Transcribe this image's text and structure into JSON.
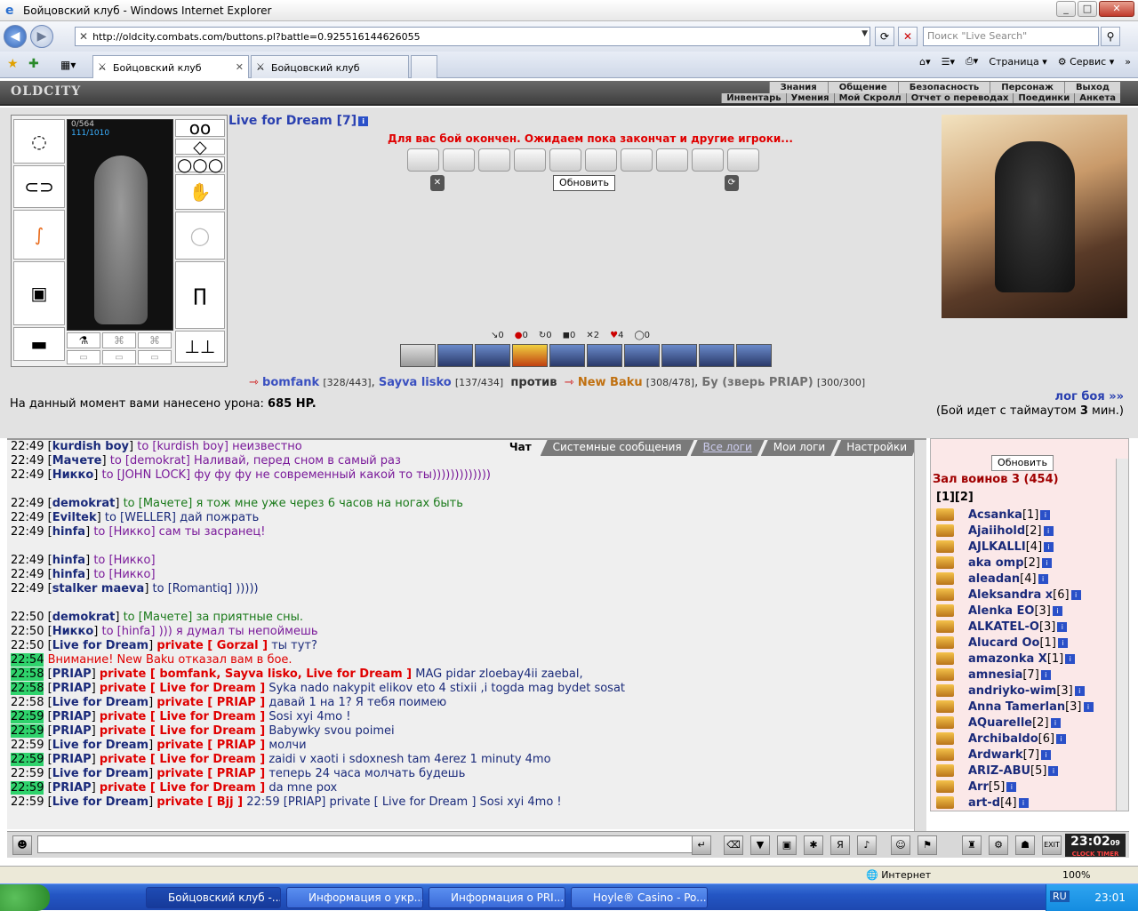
{
  "window": {
    "title": "Бойцовский клуб - Windows Internet Explorer"
  },
  "nav": {
    "url": "http://oldcity.combats.com/buttons.pl?battle=0.925516144626055",
    "search_placeholder": "Поиск \"Live Search\""
  },
  "tabs": [
    {
      "label": "Бойцовский клуб"
    },
    {
      "label": "Бойцовский клуб"
    }
  ],
  "commands": {
    "page": "Страница",
    "service": "Сервис"
  },
  "game": {
    "logo": "OLDCITY",
    "menu": [
      "Знания",
      "Общение",
      "Безопасность",
      "Персонаж",
      "Выход"
    ],
    "submenu": [
      "Инвентарь",
      "Умения",
      "Мой Скролл",
      "Отчет о переводах",
      "Поединки",
      "Анкета"
    ],
    "hp_top": "0/564",
    "hp_bottom": "111/1010",
    "player_name": "Live for Dream [7]",
    "battle_message": "Для вас бой окончен. Ожидаем пока закончат и другие игроки...",
    "refresh": "Обновить",
    "stats": [
      "0",
      "0",
      "0",
      "0",
      "2",
      "4",
      "0"
    ],
    "team1": [
      {
        "name": "bomfank",
        "hp": "[328/443]"
      },
      {
        "name": "Sayva lisko",
        "hp": "[137/434]"
      }
    ],
    "versus": "против",
    "team2": [
      {
        "name": "New Baku",
        "hp": "[308/478]"
      },
      {
        "name": "Бу (зверь PRIAP)",
        "hp": "[300/300]"
      }
    ],
    "damage_label": "На данный момент вами нанесено урона:",
    "damage_value": "685 HP.",
    "log_link": "лог боя »»",
    "timeout_pre": "(Бой идет с таймаутом",
    "timeout_num": "3",
    "timeout_post": "мин.)"
  },
  "chat_tabs": [
    "Чат",
    "Системные сообщения",
    "Все логи",
    "Мои логи",
    "Настройки"
  ],
  "chat": [
    {
      "t": "22:49",
      "g": false,
      "who": "kurdish boy",
      "to": "to [kurdish boy] неизвестно",
      "cls": "msg-purple"
    },
    {
      "t": "22:49",
      "g": false,
      "who": "Мачете",
      "to": "to [demokrat] Наливай, перед сном в самый раз",
      "cls": "msg-purple"
    },
    {
      "t": "22:49",
      "g": false,
      "who": "Никко",
      "to": "to [JOHN LOCK] фу фу фу не современный какой то ты)))))))))))))",
      "cls": "msg-purple"
    },
    {
      "t": "",
      "g": false,
      "who": "",
      "to": "",
      "cls": "msg-blue"
    },
    {
      "t": "22:49",
      "g": false,
      "who": "demokrat",
      "to": "to [Мачете] я тож мне уже через 6 часов на ногах быть",
      "cls": "msg-green"
    },
    {
      "t": "22:49",
      "g": false,
      "who": "Eviltek",
      "to": "to [WELLER] дай пожрать",
      "cls": "msg-blue"
    },
    {
      "t": "22:49",
      "g": false,
      "who": "hinfa",
      "to": "to [Никко] сам ты засранец!",
      "cls": "msg-purple"
    },
    {
      "t": "",
      "g": false,
      "who": "",
      "to": "",
      "cls": "msg-blue"
    },
    {
      "t": "22:49",
      "g": false,
      "who": "hinfa",
      "to": "to [Никко]",
      "cls": "msg-purple"
    },
    {
      "t": "22:49",
      "g": false,
      "who": "hinfa",
      "to": "to [Никко]",
      "cls": "msg-purple"
    },
    {
      "t": "22:49",
      "g": false,
      "who": "stalker maeva",
      "to": "to [Romantiq] )))))",
      "cls": "msg-blue"
    },
    {
      "t": "",
      "g": false,
      "who": "",
      "to": "",
      "cls": "msg-blue"
    },
    {
      "t": "22:50",
      "g": false,
      "who": "demokrat",
      "to": "to [Мачете]   за приятные сны.",
      "cls": "msg-green"
    },
    {
      "t": "22:50",
      "g": false,
      "who": "Никко",
      "to": "to [hinfa] ))) я думал ты непоймешь",
      "cls": "msg-purple"
    },
    {
      "t": "22:50",
      "g": false,
      "who": "Live for Dream",
      "priv": "private [ Gorzal ]",
      "to": "ты тут?",
      "cls": "msg-blue"
    },
    {
      "t": "22:54",
      "g": true,
      "warn": "Внимание! New Baku отказал вам в бое.",
      "cls": "msg-blue"
    },
    {
      "t": "22:58",
      "g": true,
      "who": "PRIAP",
      "priv": "private [ bomfank, Sayva lisko, Live for Dream ]",
      "to": "MAG pidar zloebay4ii zaebal,",
      "cls": "msg-blue"
    },
    {
      "t": "22:58",
      "g": true,
      "who": "PRIAP",
      "priv": "private [ Live for Dream ]",
      "to": "Syka nado nakypit elikov eto 4 stixii ,i togda mag bydet sosat",
      "cls": "msg-blue"
    },
    {
      "t": "22:58",
      "g": false,
      "who": "Live for Dream",
      "priv": "private [ PRIAP ]",
      "to": "давай 1 на 1? Я тебя поимею",
      "cls": "msg-blue"
    },
    {
      "t": "22:59",
      "g": true,
      "who": "PRIAP",
      "priv": "private [ Live for Dream ]",
      "to": "Sosi xyi 4mo !",
      "cls": "msg-blue"
    },
    {
      "t": "22:59",
      "g": true,
      "who": "PRIAP",
      "priv": "private [ Live for Dream ]",
      "to": "Babywky svou poimei",
      "cls": "msg-blue"
    },
    {
      "t": "22:59",
      "g": false,
      "who": "Live for Dream",
      "priv": "private [ PRIAP ]",
      "to": "молчи",
      "cls": "msg-blue"
    },
    {
      "t": "22:59",
      "g": true,
      "who": "PRIAP",
      "priv": "private [ Live for Dream ]",
      "to": "zaidi v xaoti i sdoxnesh tam 4erez 1 minuty 4mo",
      "cls": "msg-blue"
    },
    {
      "t": "22:59",
      "g": false,
      "who": "Live for Dream",
      "priv": "private [ PRIAP ]",
      "to": "теперь 24 часа молчать будешь",
      "cls": "msg-blue"
    },
    {
      "t": "22:59",
      "g": true,
      "who": "PRIAP",
      "priv": "private [ Live for Dream ]",
      "to": "da mne pox",
      "cls": "msg-blue"
    },
    {
      "t": "22:59",
      "g": false,
      "who": "Live for Dream",
      "priv": "private [ Bjj ]",
      "to": "22:59 [PRIAP] private [ Live for Dream ] Sosi xyi 4mo !",
      "cls": "msg-blue"
    }
  ],
  "room": {
    "refresh": "Обновить",
    "title": "Зал воинов 3 (454)",
    "pages": "[1][2]",
    "players": [
      {
        "n": "Acsanka",
        "l": "[1]"
      },
      {
        "n": "Ajaiihold",
        "l": "[2]"
      },
      {
        "n": "AJLKALLI",
        "l": "[4]"
      },
      {
        "n": "aka omp",
        "l": "[2]"
      },
      {
        "n": "aleadan",
        "l": "[4]"
      },
      {
        "n": "Aleksandra x",
        "l": "[6]"
      },
      {
        "n": "Alenka EO",
        "l": "[3]"
      },
      {
        "n": "ALKATEL-O",
        "l": "[3]"
      },
      {
        "n": "Alucard Oo",
        "l": "[1]"
      },
      {
        "n": "amazonka X",
        "l": "[1]"
      },
      {
        "n": "amnesia",
        "l": "[7]"
      },
      {
        "n": "andriyko-wim",
        "l": "[3]"
      },
      {
        "n": "Anna Tamerlan",
        "l": "[3]"
      },
      {
        "n": "AQuarelle",
        "l": "[2]"
      },
      {
        "n": "Archibaldo",
        "l": "[6]"
      },
      {
        "n": "Ardwark",
        "l": "[7]"
      },
      {
        "n": "ARIZ-ABU",
        "l": "[5]"
      },
      {
        "n": "Arr",
        "l": "[5]"
      },
      {
        "n": "art-d",
        "l": "[4]"
      }
    ]
  },
  "clock": {
    "time": "23:02",
    "sec": "09",
    "label": "CLOCK TIMER"
  },
  "status": {
    "zone": "Интернет",
    "zoom": "100%"
  },
  "taskbar": {
    "items": [
      "Бойцовский клуб -...",
      "Информация о укр...",
      "Информация о PRI...",
      "Hoyle® Casino - Po..."
    ],
    "lang": "RU",
    "time": "23:01"
  }
}
